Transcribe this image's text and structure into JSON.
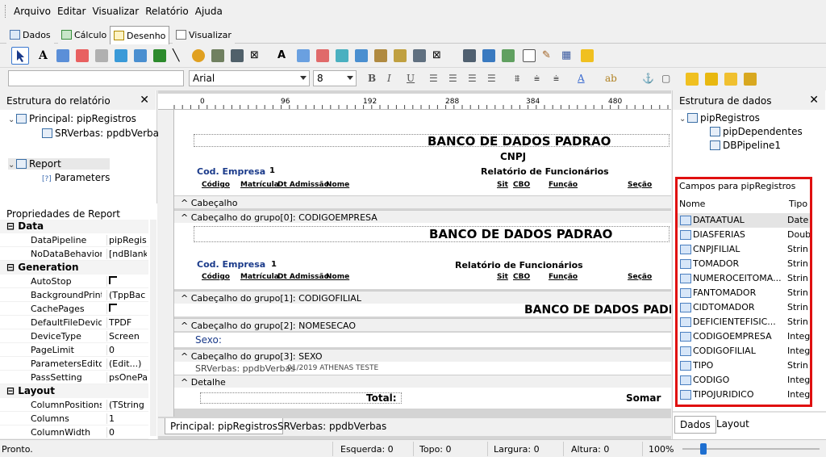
{
  "menu": [
    "Arquivo",
    "Editar",
    "Visualizar",
    "Relatório",
    "Ajuda"
  ],
  "tabs": [
    "Dados",
    "Cálculo",
    "Desenho",
    "Visualizar"
  ],
  "toolbar2": {
    "font": "Arial",
    "size": "8"
  },
  "left": {
    "title": "Estrutura do relatório",
    "tree1": "Principal: pipRegistros",
    "tree1child": "SRVerbas: ppdbVerbas",
    "tree2": "Report",
    "tree2child": "Parameters"
  },
  "props": {
    "title": "Propriedades de Report",
    "cat_data": "Data",
    "cat_gen": "Generation",
    "cat_layout": "Layout",
    "rows_data": [
      [
        "DataPipeline",
        "pipRegis"
      ],
      [
        "NoDataBehaviors",
        "[ndBlank"
      ]
    ],
    "rows_gen": [
      [
        "AutoStop",
        ""
      ],
      [
        "BackgroundPrintSe",
        "(TppBac"
      ],
      [
        "CachePages",
        ""
      ],
      [
        "DefaultFileDevice",
        "TPDF"
      ],
      [
        "DeviceType",
        "Screen"
      ],
      [
        "PageLimit",
        "0"
      ],
      [
        "ParametersEditor",
        "(Edit...)"
      ],
      [
        "PassSetting",
        "psOnePa"
      ]
    ],
    "rows_layout": [
      [
        "ColumnPositions",
        "(TString"
      ],
      [
        "Columns",
        "1"
      ],
      [
        "ColumnWidth",
        "0"
      ]
    ]
  },
  "ruler": [
    "0",
    "96",
    "192",
    "288",
    "384",
    "480"
  ],
  "design": {
    "banco": "BANCO DE DADOS PADRAO",
    "bancoCut": "BANCO DE DADOS PADR",
    "cnpj": "CNPJ",
    "codEmpresa": "Cod. Empresa",
    "one": "1",
    "relFunc": "Relatório de Funcionários",
    "cols": [
      "Código",
      "Matrícula",
      "Dt Admissão",
      "Nome",
      "Sit",
      "CBO",
      "Função",
      "Seção"
    ],
    "bands": [
      "Cabeçalho",
      "Cabeçalho do grupo[0]: CODIGOEMPRESA",
      "Cabeçalho do grupo[1]: CODIGOFILIAL",
      "Cabeçalho do grupo[2]: NOMESECAO",
      "Cabeçalho do grupo[3]: SEXO",
      "Detalhe"
    ],
    "sexo": "Sexo:",
    "srverbas": "SRVerbas: ppdbVerbas",
    "detailText": "01/2019   ATHENAS TESTE",
    "total": "Total:",
    "soma": "Somar",
    "zero": "0"
  },
  "bottomTabs": [
    "Principal: pipRegistros",
    "SRVerbas: ppdbVerbas"
  ],
  "right": {
    "title": "Estrutura de dados",
    "tree": [
      "pipRegistros",
      "pipDependentes",
      "DBPipeline1"
    ],
    "fieldsTitle": "Campos para pipRegistros",
    "colName": "Nome",
    "colType": "Tipo",
    "fields": [
      [
        "DATAATUAL",
        "Date"
      ],
      [
        "DIASFERIAS",
        "Doub"
      ],
      [
        "CNPJFILIAL",
        "Strin"
      ],
      [
        "TOMADOR",
        "Strin"
      ],
      [
        "NUMEROCEITOMA...",
        "Strin"
      ],
      [
        "FANTOMADOR",
        "Strin"
      ],
      [
        "CIDTOMADOR",
        "Strin"
      ],
      [
        "DEFICIENTEFISIC...",
        "Strin"
      ],
      [
        "CODIGOEMPRESA",
        "Integ"
      ],
      [
        "CODIGOFILIAL",
        "Integ"
      ],
      [
        "TIPO",
        "Strin"
      ],
      [
        "CODIGO",
        "Integ"
      ],
      [
        "TIPOJURIDICO",
        "Integ"
      ]
    ],
    "tabs": [
      "Dados",
      "Layout"
    ]
  },
  "status": {
    "msg": "Pronto.",
    "esq": "Esquerda: 0",
    "topo": "Topo: 0",
    "larg": "Largura: 0",
    "alt": "Altura: 0",
    "zoom": "100%"
  }
}
